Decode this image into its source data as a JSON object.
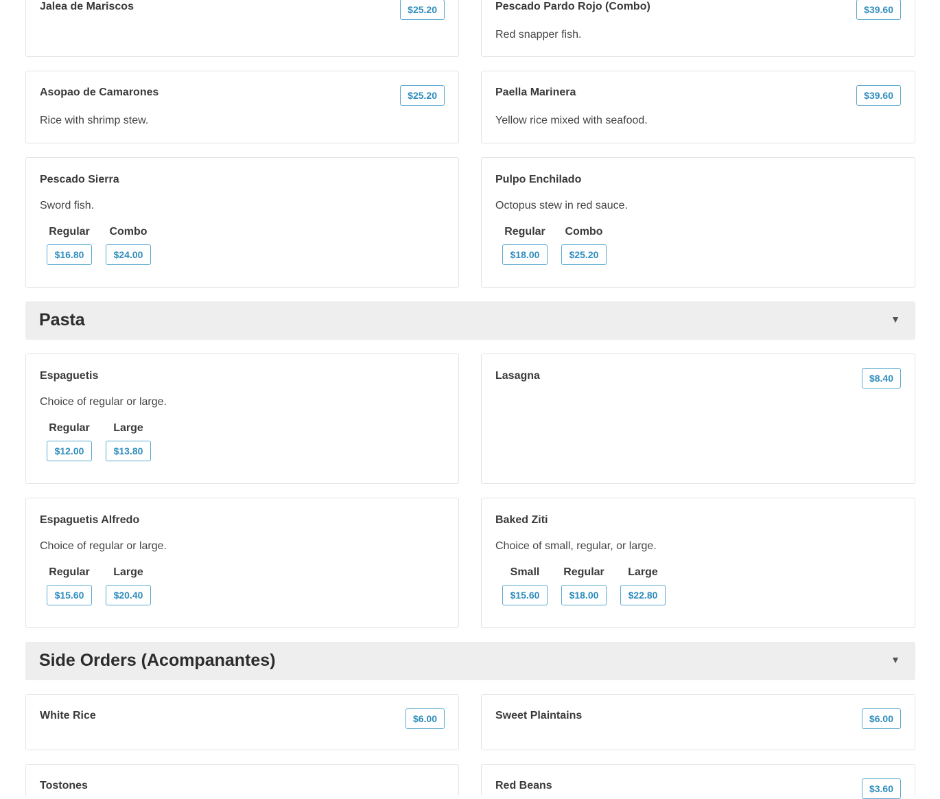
{
  "seafood_items": [
    {
      "name": "Jalea de Mariscos",
      "price": "$25.20"
    },
    {
      "name": "Pescado Pardo Rojo (Combo)",
      "price": "$39.60",
      "desc": "Red snapper fish."
    },
    {
      "name": "Asopao de Camarones",
      "price": "$25.20",
      "desc": "Rice with shrimp stew."
    },
    {
      "name": "Paella Marinera",
      "price": "$39.60",
      "desc": "Yellow rice mixed with seafood."
    },
    {
      "name": "Pescado Sierra",
      "desc": "Sword fish.",
      "options": [
        {
          "label": "Regular",
          "price": "$16.80"
        },
        {
          "label": "Combo",
          "price": "$24.00"
        }
      ]
    },
    {
      "name": "Pulpo Enchilado",
      "desc": "Octopus stew in red sauce.",
      "options": [
        {
          "label": "Regular",
          "price": "$18.00"
        },
        {
          "label": "Combo",
          "price": "$25.20"
        }
      ]
    }
  ],
  "sections": [
    {
      "title": "Pasta",
      "chevron": "▼"
    },
    {
      "title": "Side Orders (Acompanantes)",
      "chevron": "▼"
    }
  ],
  "pasta_items": [
    {
      "name": "Espaguetis",
      "desc": "Choice of regular or large.",
      "options": [
        {
          "label": "Regular",
          "price": "$12.00"
        },
        {
          "label": "Large",
          "price": "$13.80"
        }
      ]
    },
    {
      "name": "Lasagna",
      "price": "$8.40"
    },
    {
      "name": "Espaguetis Alfredo",
      "desc": "Choice of regular or large.",
      "options": [
        {
          "label": "Regular",
          "price": "$15.60"
        },
        {
          "label": "Large",
          "price": "$20.40"
        }
      ]
    },
    {
      "name": "Baked Ziti",
      "desc": "Choice of small, regular, or large.",
      "options": [
        {
          "label": "Small",
          "price": "$15.60"
        },
        {
          "label": "Regular",
          "price": "$18.00"
        },
        {
          "label": "Large",
          "price": "$22.80"
        }
      ]
    }
  ],
  "side_items": [
    {
      "name": "White Rice",
      "price": "$6.00"
    },
    {
      "name": "Sweet Plaintains",
      "price": "$6.00"
    },
    {
      "name": "Tostones"
    },
    {
      "name": "Red Beans",
      "price": "$3.60"
    }
  ],
  "colors": {
    "accent": "#2f8dbd",
    "section_bg": "#eeeeee",
    "border": "#e3e3e3"
  },
  "icons": {
    "section_toggle": "chevron-down-icon"
  }
}
